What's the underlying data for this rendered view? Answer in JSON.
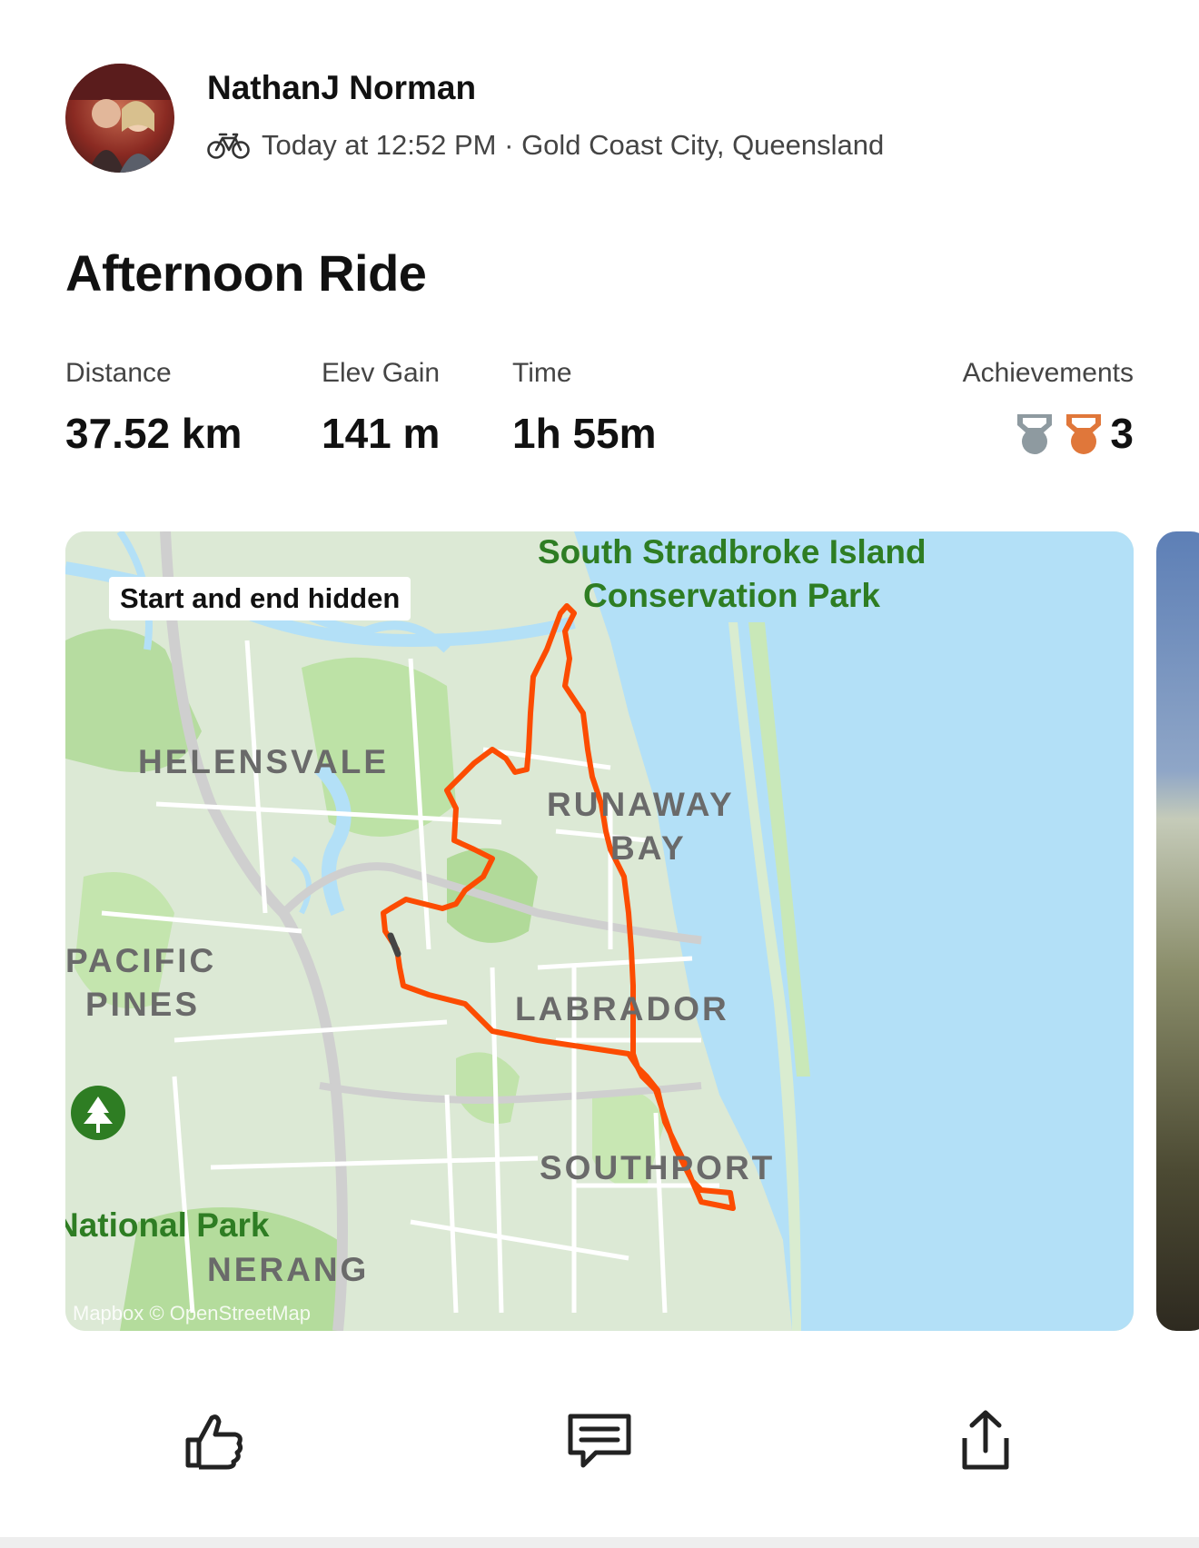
{
  "athlete": {
    "name": "NathanJ Norman",
    "activity_type_icon": "bike-icon",
    "timestamp": "Today at 12:52 PM",
    "separator": " · ",
    "location": "Gold Coast City, Queensland"
  },
  "activity": {
    "title": "Afternoon Ride"
  },
  "stats": [
    {
      "label": "Distance",
      "value": "37.52 km"
    },
    {
      "label": "Elev Gain",
      "value": "141 m"
    },
    {
      "label": "Time",
      "value": "1h 55m"
    }
  ],
  "achievements": {
    "label": "Achievements",
    "count": "3",
    "icons": [
      "silver-medal-icon",
      "bronze-medal-icon"
    ],
    "colors": {
      "silver": "#8e9aa0",
      "bronze": "#e0773a"
    }
  },
  "map": {
    "privacy_badge": "Start and end hidden",
    "labels": {
      "park_line1": "South Stradbroke Island",
      "park_line2": "Conservation Park",
      "helensvale": "HELENSVALE",
      "runaway": "RUNAWAY",
      "bay": "BAY",
      "pacific": "PACIFIC",
      "pines": "PINES",
      "labrador": "LABRADOR",
      "southport": "SOUTHPORT",
      "national_park": "National Park",
      "nerang": "NERANG"
    },
    "attribution": "Mapbox © OpenStreetMap",
    "route_color": "#fc4c02",
    "water_color": "#b3e0f7"
  },
  "actions": [
    {
      "icon": "thumbs-up-icon"
    },
    {
      "icon": "comment-icon"
    },
    {
      "icon": "share-icon"
    }
  ]
}
